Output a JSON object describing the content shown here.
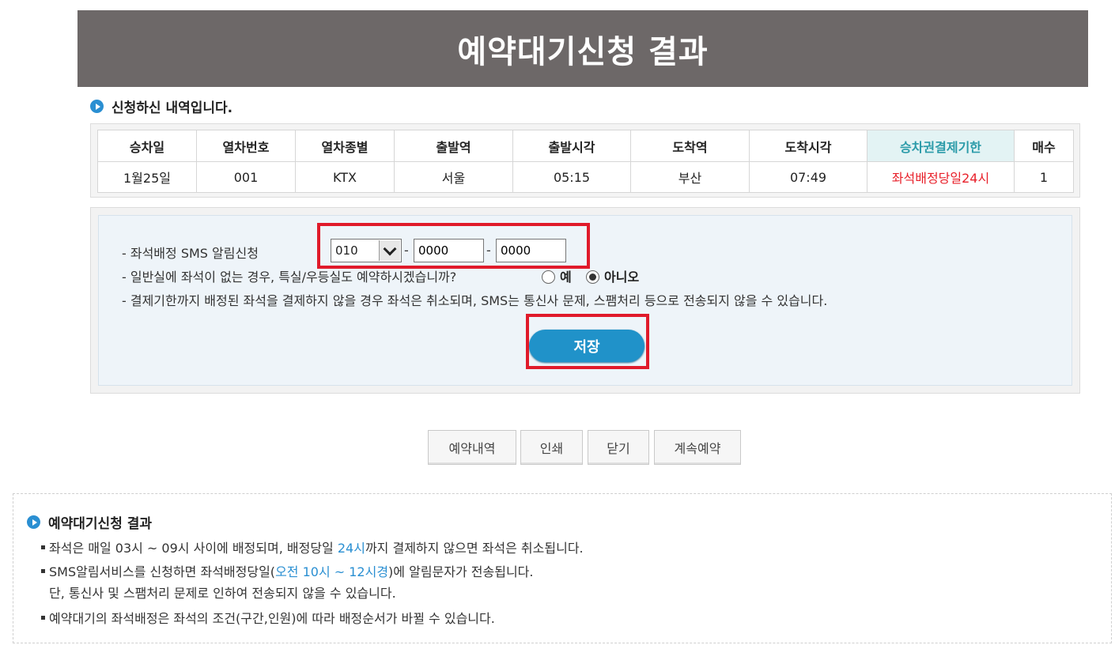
{
  "header": {
    "title": "예약대기신청 결과"
  },
  "section": {
    "title": "신청하신 내역입니다."
  },
  "table": {
    "columns": [
      "승차일",
      "열차번호",
      "열차종별",
      "출발역",
      "출발시각",
      "도착역",
      "도착시각",
      "승차권결제기한",
      "매수"
    ],
    "row": [
      "1월25일",
      "001",
      "KTX",
      "서울",
      "05:15",
      "부산",
      "07:49",
      "좌석배정당일24시",
      "1"
    ]
  },
  "form": {
    "sms_label": "- 좌석배정 SMS 알림신청",
    "phone_prefix": "010",
    "phone_mid": "0000",
    "phone_last": "0000",
    "dash": "-",
    "question": "- 일반실에 좌석이 없는 경우, 특실/우등실도 예약하시겠습니까?",
    "yes_label": "예",
    "no_label": "아니오",
    "selected": "아니오",
    "notice": "- 결제기한까지 배정된 좌석을 결제하지 않을 경우 좌석은 취소되며, SMS는 통신사 문제, 스팸처리 등으로 전송되지 않을 수 있습니다.",
    "save_label": "저장"
  },
  "buttons": {
    "reservations": "예약내역",
    "print": "인쇄",
    "close": "닫기",
    "continue": "계속예약"
  },
  "info": {
    "title": "예약대기신청 결과",
    "l1_a": "좌석은 매일 03시 ~ 09시 사이에 배정되며, 배정당일 ",
    "l1_b": "24시",
    "l1_c": "까지 결제하지 않으면 좌석은 취소됩니다.",
    "l2_a": "SMS알림서비스를 신청하면 좌석배정당일(",
    "l2_b": "오전 10시 ~ 12시경",
    "l2_c": ")에 알림문자가 전송됩니다.",
    "l3": "단, 통신사 및 스팸처리 문제로 인하여 전송되지 않을 수 있습니다.",
    "l4": "예약대기의 좌석배정은 좌석의 조건(구간,인원)에 따라 배정순서가 바뀔 수 있습니다."
  },
  "colors": {
    "header_bg": "#6d6868",
    "accent_blue": "#2092c9",
    "deadline_red": "#e8202a",
    "highlight_box": "#e01a2a"
  }
}
